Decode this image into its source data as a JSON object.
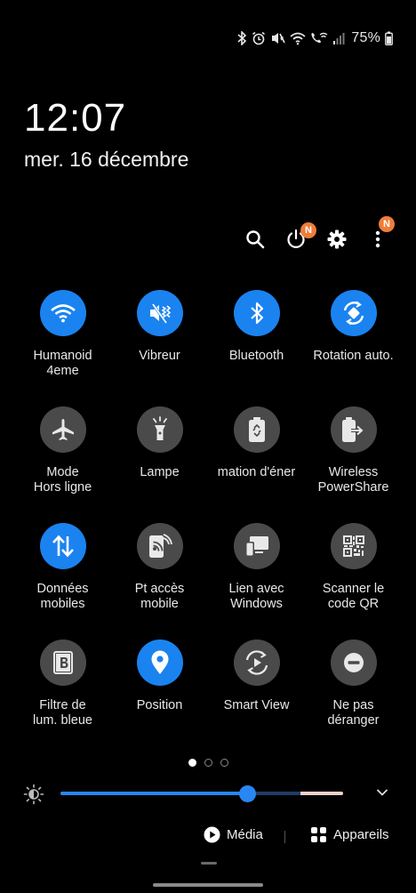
{
  "status_bar": {
    "icons": [
      "bluetooth-icon",
      "alarm-icon",
      "vibrate-icon",
      "wifi-icon",
      "wifi-calling-icon",
      "signal-icon",
      "battery-icon"
    ],
    "battery": "75%"
  },
  "lock": {
    "time": "12:07",
    "date": "mer. 16 décembre"
  },
  "top_actions": {
    "items": [
      "search-icon",
      "power-icon",
      "gear-icon",
      "more-icon"
    ],
    "power_badge": "N",
    "more_badge": "N",
    "badge_color": "#f07d3a"
  },
  "colors": {
    "tile_on": "#1a83f0",
    "tile_off": "#4a4a4a",
    "background": "#000000"
  },
  "tiles": [
    {
      "label": "Humanoid\n4eme",
      "icon": "wifi-icon",
      "state": "on"
    },
    {
      "label": "Vibreur",
      "icon": "vibrate-icon",
      "state": "on"
    },
    {
      "label": "Bluetooth",
      "icon": "bluetooth-icon",
      "state": "on"
    },
    {
      "label": "Rotation auto.",
      "icon": "rotation-icon",
      "state": "on"
    },
    {
      "label": "Mode\nHors ligne",
      "icon": "airplane-icon",
      "state": "off"
    },
    {
      "label": "Lampe",
      "icon": "flashlight-icon",
      "state": "off"
    },
    {
      "label": "mation d'éner",
      "icon": "battery-saver-icon",
      "state": "off"
    },
    {
      "label": "Wireless\nPowerShare",
      "icon": "powershare-icon",
      "state": "off"
    },
    {
      "label": "Données\nmobiles",
      "icon": "mobile-data-icon",
      "state": "on"
    },
    {
      "label": "Pt accès\nmobile",
      "icon": "hotspot-icon",
      "state": "off"
    },
    {
      "label": "Lien avec\nWindows",
      "icon": "link-windows-icon",
      "state": "off"
    },
    {
      "label": "Scanner le\ncode QR",
      "icon": "qr-code-icon",
      "state": "off"
    },
    {
      "label": "Filtre de\nlum. bleue",
      "icon": "blue-light-filter-icon",
      "state": "off"
    },
    {
      "label": "Position",
      "icon": "location-icon",
      "state": "on"
    },
    {
      "label": "Smart View",
      "icon": "smart-view-icon",
      "state": "off"
    },
    {
      "label": "Ne pas\ndéranger",
      "icon": "do-not-disturb-icon",
      "state": "off"
    }
  ],
  "pager": {
    "pages": 3,
    "active": 1
  },
  "brightness": {
    "level": 0.66
  },
  "media": {
    "media_label": "Média",
    "devices_label": "Appareils"
  }
}
